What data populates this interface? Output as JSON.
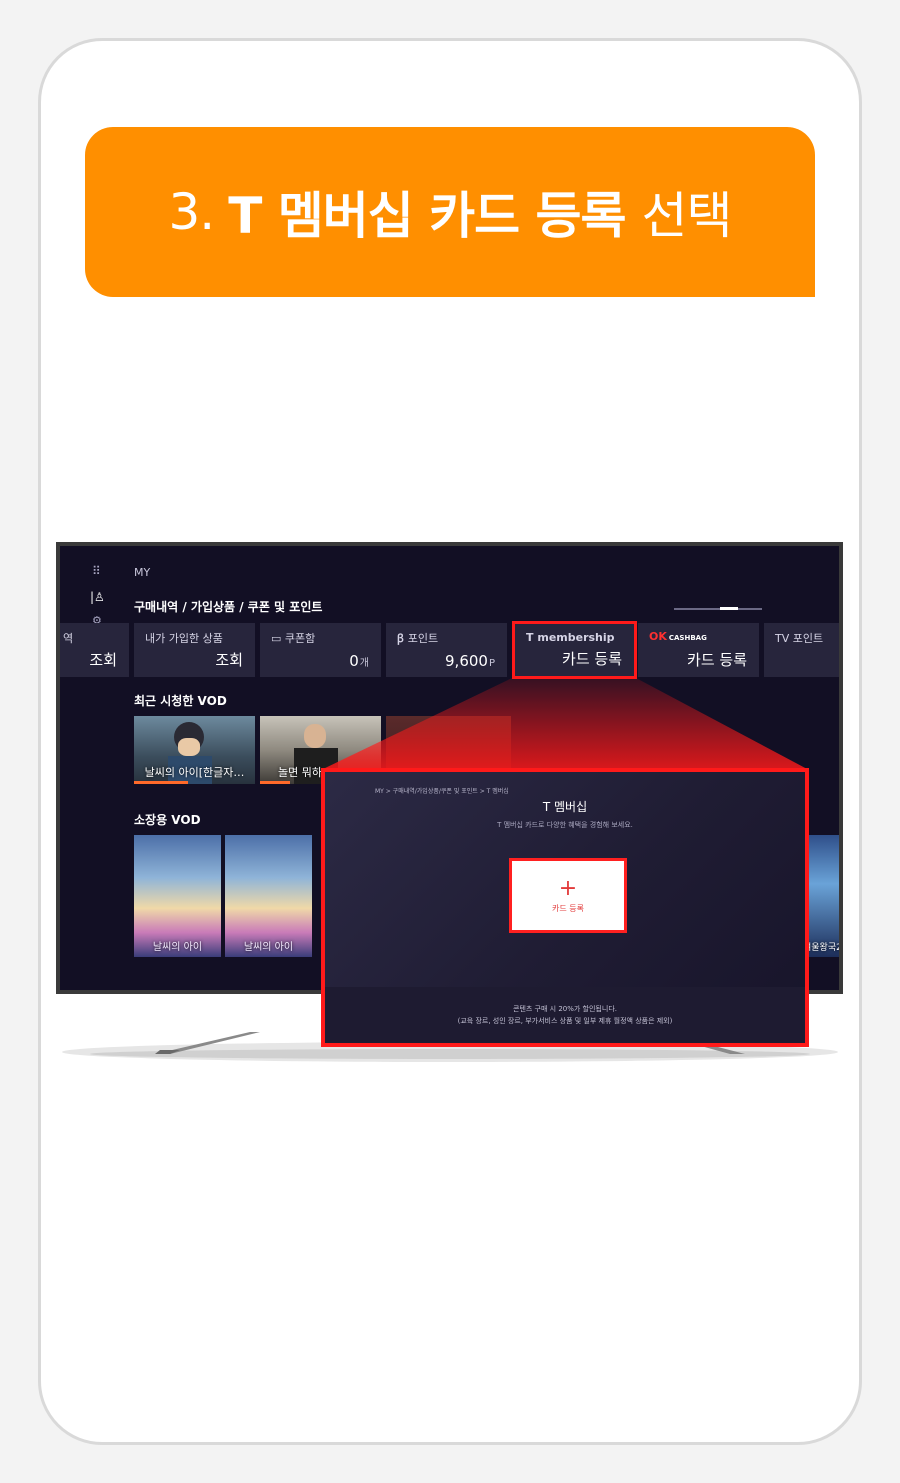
{
  "banner": {
    "number": "3.",
    "highlight": "T 멤버십 카드 등록",
    "suffix": "선택"
  },
  "tv": {
    "header": "MY",
    "sections": {
      "purchase": "구매내역 / 가입상품 / 쿠폰 및 포인트",
      "recent": "최근 시청한 VOD",
      "owned": "소장용 VOD"
    },
    "tiles": [
      {
        "label": "역",
        "value": "조회"
      },
      {
        "label": "내가 가입한 상품",
        "value": "조회"
      },
      {
        "label": "쿠폰함",
        "value": "0",
        "unit": "개"
      },
      {
        "label": "포인트",
        "value": "9,600",
        "unit": "P"
      },
      {
        "label": "membership",
        "value": "카드 등록"
      },
      {
        "label": "CASHBAG",
        "value": "카드 등록"
      },
      {
        "label": "TV 포인트",
        "value": ""
      }
    ],
    "recent_vod": [
      {
        "title": "날씨의 아이[한글자…",
        "progress": 0.45
      },
      {
        "title": "놀면 뭐하",
        "progress": 0.25
      }
    ],
    "owned_vod": [
      {
        "title": "날씨의 아이"
      },
      {
        "title": "날씨의 아이"
      },
      {
        "title": "겨울왕국2"
      }
    ]
  },
  "popup": {
    "breadcrumb": "MY > 구매내역/가입상품/쿠폰 및 포인트 > T 멤버십",
    "title": "T 멤버십",
    "subtitle": "T 멤버십 카드로 다양한 혜택을 경험해 보세요.",
    "add_label": "카드 등록",
    "footer_line1": "콘텐츠 구매 시 20%가 할인됩니다.",
    "footer_line2": "(교육 장르, 성인 장르, 부가서비스 상품 및 일부 제휴 월정액 상품은 제외)"
  },
  "colors": {
    "brand_orange": "#ff8f00",
    "highlight_red": "#ff1a1a",
    "tv_bg": "#120f24"
  }
}
